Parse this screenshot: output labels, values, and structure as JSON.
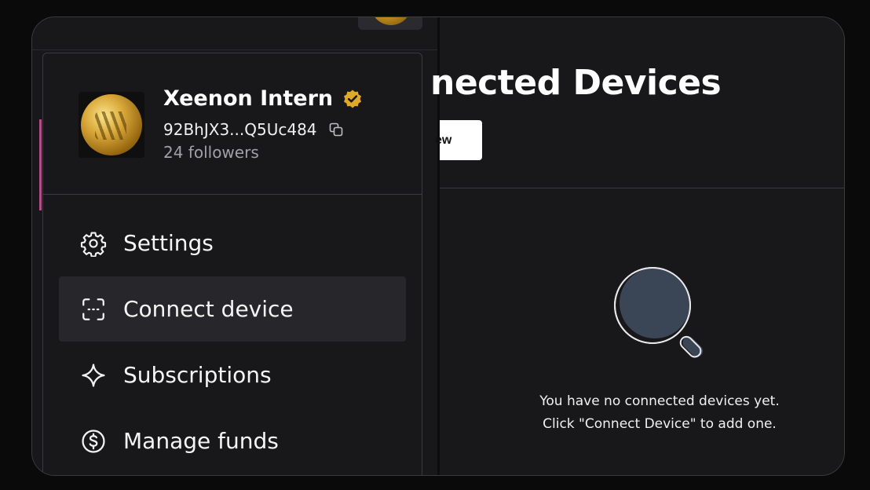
{
  "main": {
    "title": "nected Devices",
    "new_button_label": "ew",
    "empty_state": {
      "line1": "You have no connected devices yet.",
      "line2": "Click \"Connect Device\" to add one.",
      "icon": "magnifier-icon"
    }
  },
  "profile": {
    "name": "Xeenon Intern",
    "address": "92BhJX3...Q5Uc484",
    "followers": "24 followers",
    "verified_icon": "verified-badge-icon",
    "verified_color": "#e0a92a"
  },
  "menu": {
    "items": [
      {
        "label": "Settings",
        "icon": "gear-icon",
        "active": false
      },
      {
        "label": "Connect device",
        "icon": "scan-frame-icon",
        "active": true
      },
      {
        "label": "Subscriptions",
        "icon": "sparkle-icon",
        "active": false
      },
      {
        "label": "Manage funds",
        "icon": "dollar-circle-icon",
        "active": false
      }
    ]
  },
  "colors": {
    "background": "#18181b",
    "accent_pink": "#b44d8a",
    "active_item": "#27272b"
  }
}
